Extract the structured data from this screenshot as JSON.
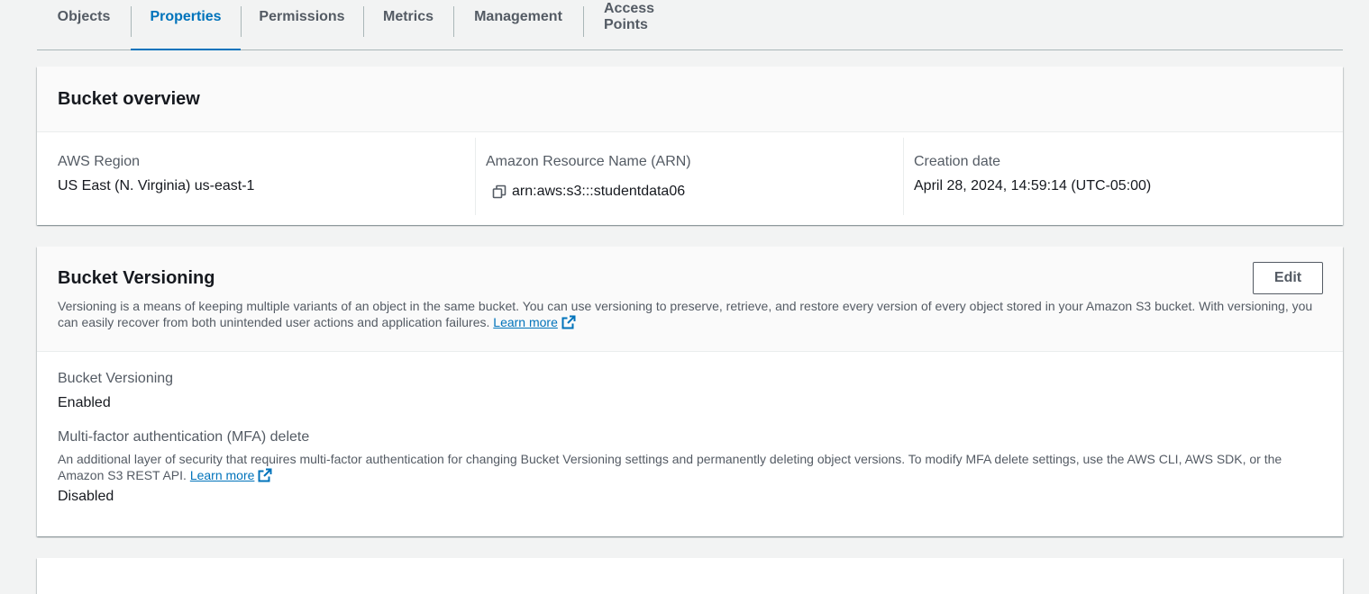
{
  "tabs": [
    {
      "label": "Objects",
      "active": false
    },
    {
      "label": "Properties",
      "active": true
    },
    {
      "label": "Permissions",
      "active": false
    },
    {
      "label": "Metrics",
      "active": false
    },
    {
      "label": "Management",
      "active": false
    },
    {
      "label": "Access Points",
      "active": false
    }
  ],
  "overview": {
    "title": "Bucket overview",
    "region_label": "AWS Region",
    "region_value": "US East (N. Virginia) us-east-1",
    "arn_label": "Amazon Resource Name (ARN)",
    "arn_value": "arn:aws:s3:::studentdata06",
    "created_label": "Creation date",
    "created_value": "April 28, 2024, 14:59:14 (UTC-05:00)"
  },
  "versioning": {
    "title": "Bucket Versioning",
    "edit_label": "Edit",
    "description": "Versioning is a means of keeping multiple variants of an object in the same bucket. You can use versioning to preserve, retrieve, and restore every version of every object stored in your Amazon S3 bucket. With versioning, you can easily recover from both unintended user actions and application failures.",
    "learn_more": "Learn more",
    "status_label": "Bucket Versioning",
    "status_value": "Enabled",
    "mfa_label": "Multi-factor authentication (MFA) delete",
    "mfa_description": "An additional layer of security that requires multi-factor authentication for changing Bucket Versioning settings and permanently deleting object versions. To modify MFA delete settings, use the AWS CLI, AWS SDK, or the Amazon S3 REST API.",
    "mfa_learn_more": "Learn more",
    "mfa_value": "Disabled"
  },
  "colors": {
    "accent": "#0073bb",
    "text": "#16191f",
    "secondary_text": "#545b64",
    "background": "#f2f3f3"
  },
  "icons": {
    "copy": "copy-icon",
    "external": "external-link-icon"
  }
}
